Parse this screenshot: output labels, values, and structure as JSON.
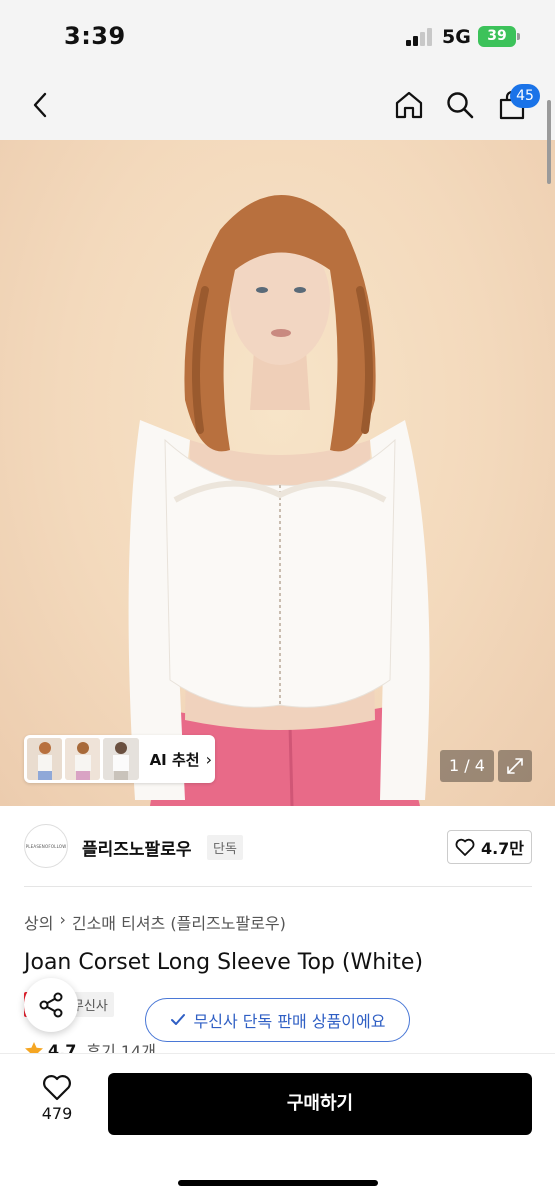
{
  "status_bar": {
    "time": "3:39",
    "network": "5G",
    "battery": "39"
  },
  "nav": {
    "cart_count": "45",
    "icons": [
      "back-icon",
      "home-icon",
      "search-icon",
      "cart-icon"
    ]
  },
  "gallery": {
    "page_counter": "1 / 4",
    "ai_label": "AI 추천"
  },
  "brand": {
    "logo_text": "PLEASENOFOLLOW",
    "name": "플리즈노팔로우",
    "exclusive_tag": "단독",
    "like_count": "4.7만"
  },
  "product": {
    "breadcrumb": [
      "상의",
      "긴소매 티셔츠 (플리즈노팔로우)"
    ],
    "title": "Joan Corset Long Sleeve Top (White)",
    "badges": {
      "sale": "세일",
      "musinsa": "무신사"
    },
    "rating": "4.7",
    "reviews": "후기 14개"
  },
  "toast": {
    "text": "무신사 단독 판매 상품이에요"
  },
  "bottom": {
    "wish_count": "479",
    "buy_label": "구매하기"
  },
  "colors": {
    "accent_blue": "#1a73e8",
    "sale_red": "#e5202e",
    "buy_black": "#000000"
  }
}
